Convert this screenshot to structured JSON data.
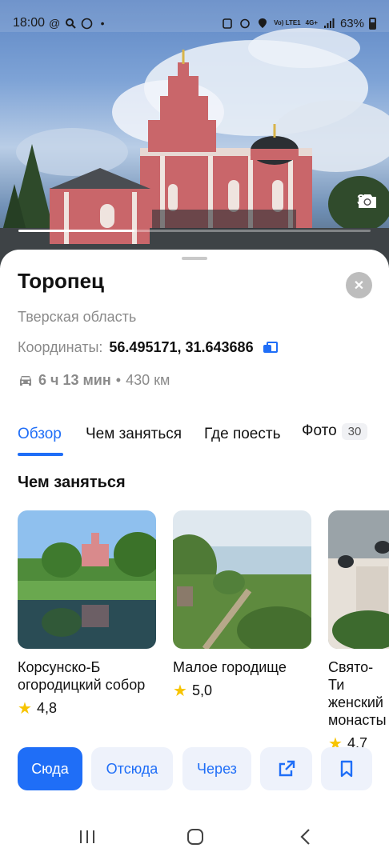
{
  "status_bar": {
    "time": "18:00",
    "net_label": "Vo) LTE1",
    "signal_label": "4G+",
    "battery": "63%"
  },
  "hero": {
    "photo_count": "30",
    "progress_fraction": 0.33
  },
  "place": {
    "title": "Торопец",
    "region": "Тверская область",
    "coords_label": "Координаты:",
    "coords_value": "56.495171, 31.643686",
    "route_duration": "6 ч 13 мин",
    "route_separator": "•",
    "route_distance": "430 км"
  },
  "tabs": [
    {
      "label": "Обзор",
      "active": true
    },
    {
      "label": "Чем заняться"
    },
    {
      "label": "Где поесть"
    },
    {
      "label": "Фото",
      "badge": "30"
    }
  ],
  "section": {
    "title": "Чем заняться"
  },
  "cards": [
    {
      "name": "Корсунско-Б огородицкий собор",
      "rating": "4,8"
    },
    {
      "name": "Малое городище",
      "rating": "5,0"
    },
    {
      "name": "Свято-Ти женский монасты",
      "rating": "4,7"
    }
  ],
  "actions": {
    "here": "Сюда",
    "from": "Отсюда",
    "via": "Через",
    "share_icon": "share-icon",
    "bookmark_icon": "bookmark-icon"
  },
  "colors": {
    "accent": "#1f6ef7",
    "star": "#f7c400"
  }
}
